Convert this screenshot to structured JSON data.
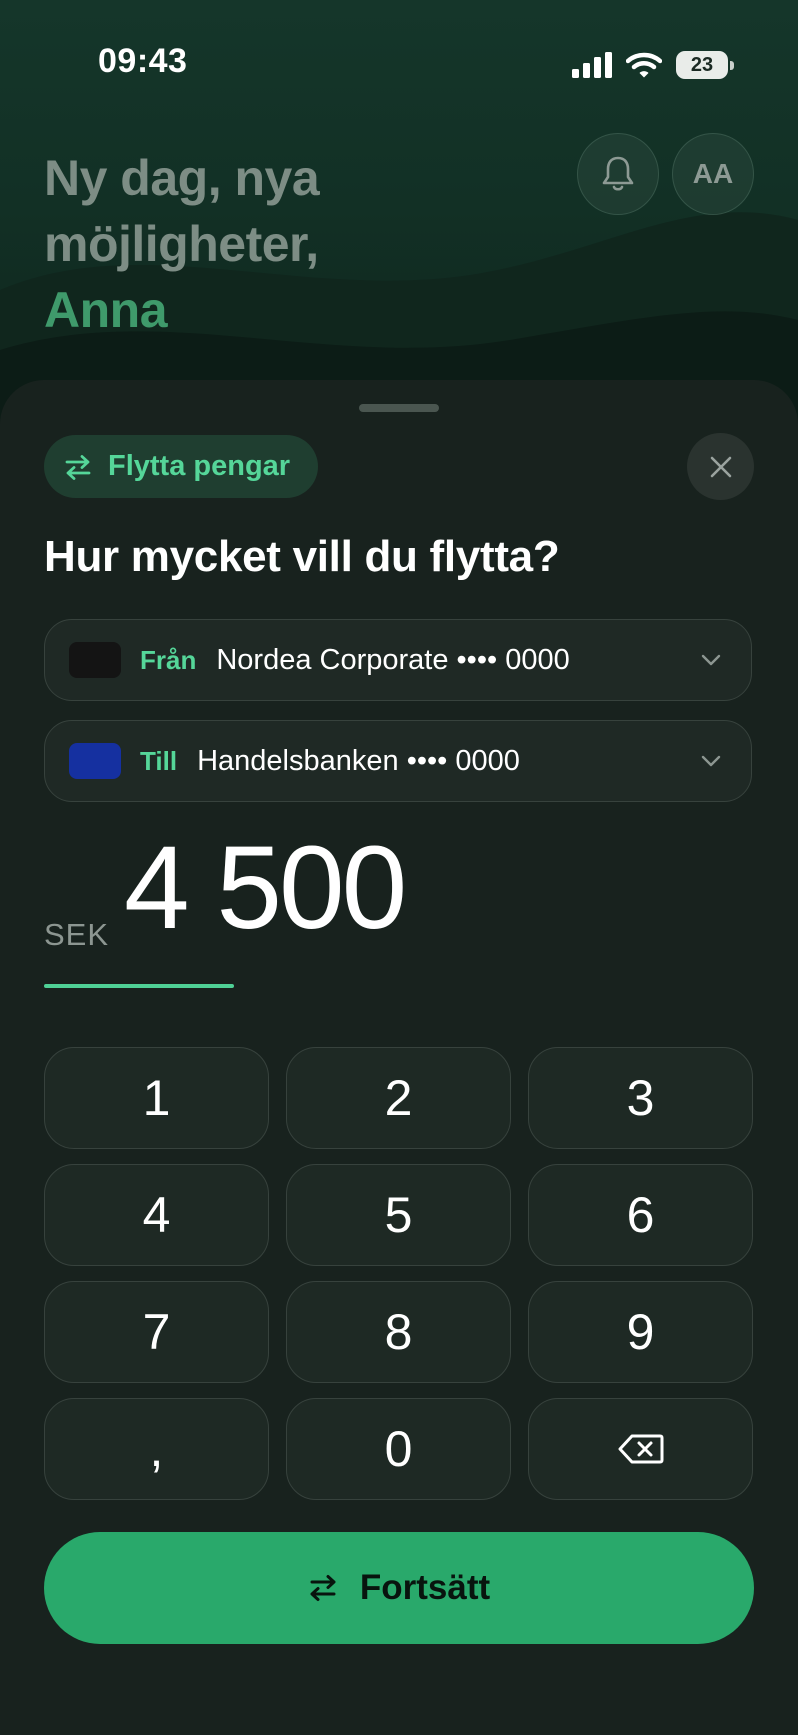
{
  "status_bar": {
    "time": "09:43",
    "battery": "23",
    "icons": [
      "signal-icon",
      "wifi-icon",
      "battery-icon"
    ]
  },
  "header": {
    "greeting_line1": "Ny dag, nya",
    "greeting_line2": "möjligheter,",
    "name": "Anna",
    "avatar_initials": "AA",
    "bell_icon": "bell-icon"
  },
  "sheet": {
    "chip_label": "Flytta pengar",
    "chip_icon": "transfer-arrows-icon",
    "question": "Hur mycket vill du flytta?",
    "from": {
      "label": "Från",
      "account": "Nordea Corporate •••• 0000",
      "swatch_color": "#141414"
    },
    "to": {
      "label": "Till",
      "account": "Handelsbanken •••• 0000",
      "swatch_color": "#1530a0"
    },
    "currency": "SEK",
    "amount": "4 500",
    "keypad": [
      "1",
      "2",
      "3",
      "4",
      "5",
      "6",
      "7",
      "8",
      "9",
      ",",
      "0"
    ],
    "continue_label": "Fortsätt"
  },
  "colors": {
    "accent": "#55d699",
    "button": "#29a96b",
    "sheet": "#18221e"
  }
}
